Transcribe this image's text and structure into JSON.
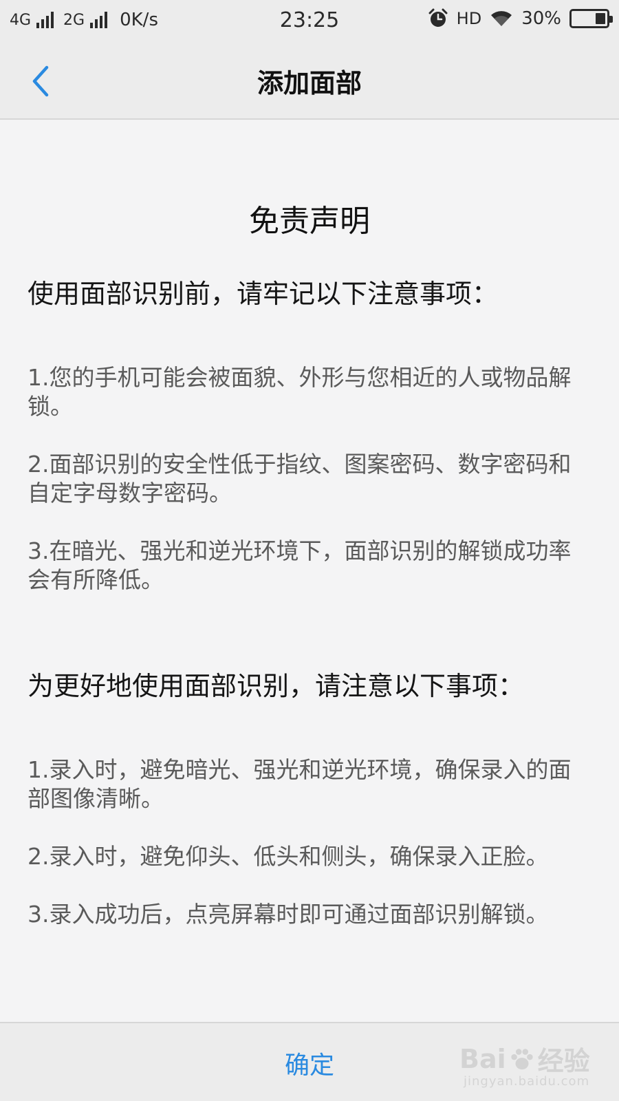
{
  "status_bar": {
    "net1": "4G",
    "net2": "2G",
    "speed": "0K/s",
    "time": "23:25",
    "hd": "HD",
    "battery_pct": "30%",
    "battery_level": 0.3,
    "icons": [
      "signal-icon",
      "signal-icon",
      "alarm-icon",
      "wifi-icon",
      "battery-icon"
    ]
  },
  "nav": {
    "title": "添加面部",
    "back_icon": "chevron-left-icon"
  },
  "content": {
    "doc_title": "免责声明",
    "section1_heading": "使用面部识别前，请牢记以下注意事项：",
    "section1_items": [
      "1.您的手机可能会被面貌、外形与您相近的人或物品解锁。",
      "2.面部识别的安全性低于指纹、图案密码、数字密码和自定字母数字密码。",
      "3.在暗光、强光和逆光环境下，面部识别的解锁成功率会有所降低。"
    ],
    "section2_heading": "为更好地使用面部识别，请注意以下事项：",
    "section2_items": [
      "1.录入时，避免暗光、强光和逆光环境，确保录入的面部图像清晰。",
      "2.录入时，避免仰头、低头和侧头，确保录入正脸。",
      "3.录入成功后，点亮屏幕时即可通过面部识别解锁。"
    ]
  },
  "bottom": {
    "confirm_label": "确定"
  },
  "watermark": {
    "brand_text": "Bai",
    "brand_text2": "经验",
    "url": "jingyan.baidu.com"
  },
  "colors": {
    "accent": "#2a8ae0",
    "bar_bg": "#ececec",
    "page_bg": "#f4f4f5"
  }
}
